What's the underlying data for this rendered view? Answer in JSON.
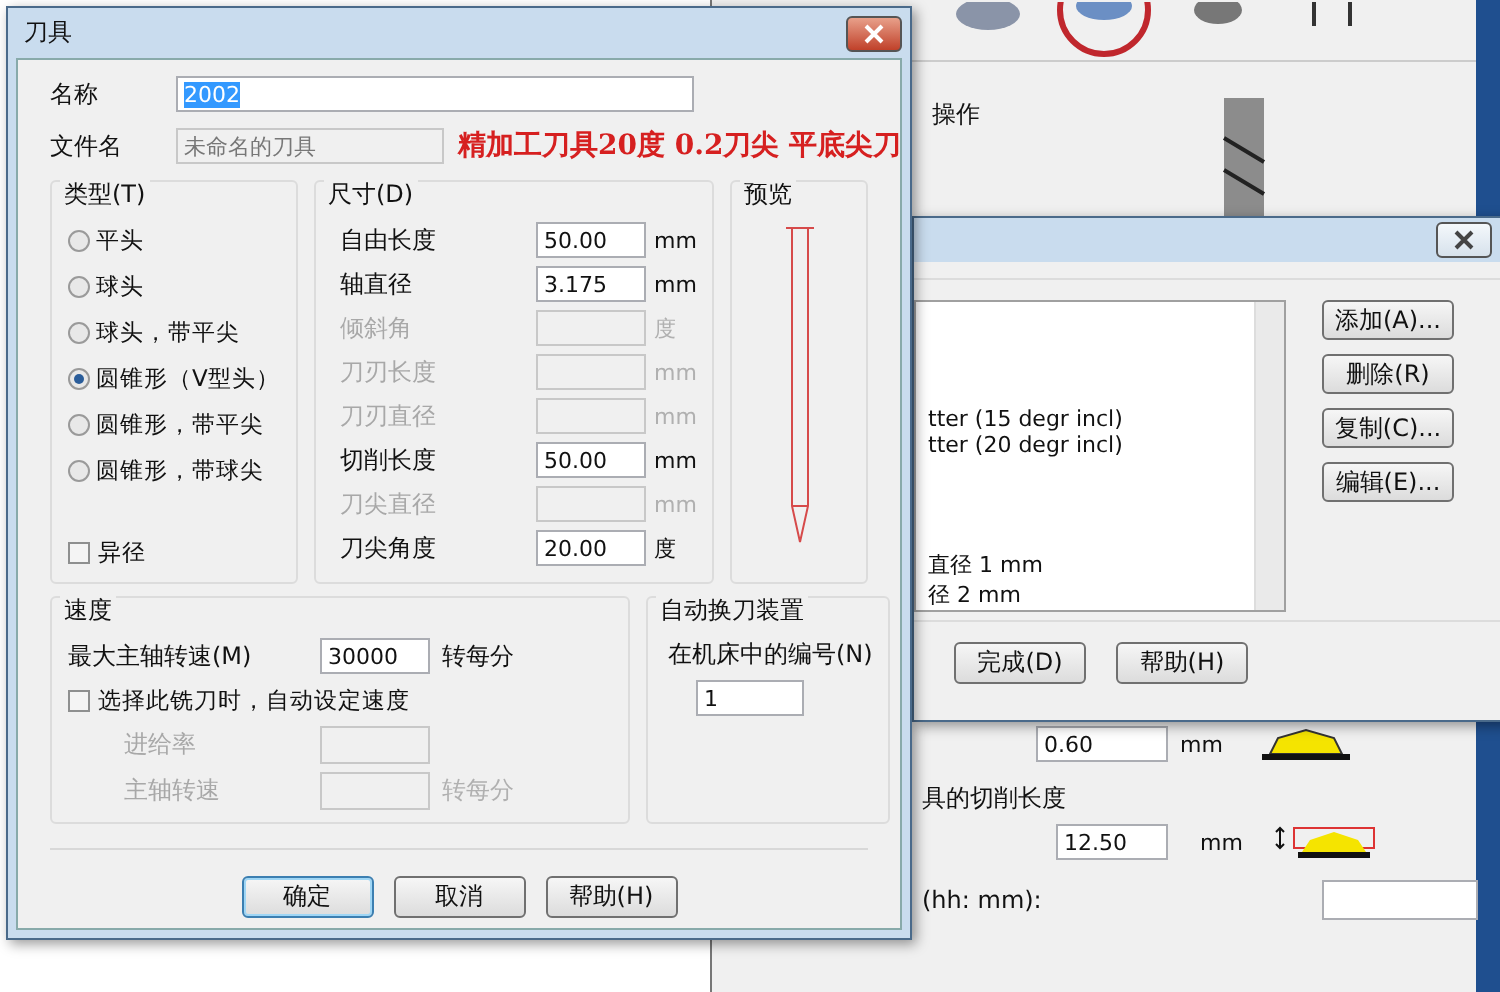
{
  "tool_dialog": {
    "title": "刀具",
    "name": {
      "label": "名称",
      "value": "2002",
      "selected": true
    },
    "file_name": {
      "label": "文件名",
      "value": "未命名的刀具",
      "disabled": true
    },
    "annotation": "精加工刀具20度 0.2刀尖 平底尖刀",
    "type_group": {
      "title": "类型(T)",
      "options": [
        {
          "label": "平头",
          "selected": false
        },
        {
          "label": "球头",
          "selected": false
        },
        {
          "label": "球头，带平尖",
          "selected": false
        },
        {
          "label": "圆锥形（V型头）",
          "selected": true
        },
        {
          "label": "圆锥形，带平尖",
          "selected": false
        },
        {
          "label": "圆锥形，带球尖",
          "selected": false
        }
      ],
      "odd_diameter": {
        "label": "异径",
        "checked": false
      }
    },
    "dimensions": {
      "title": "尺寸(D)",
      "rows": [
        {
          "label": "自由长度",
          "value": "50.00",
          "unit": "mm",
          "disabled": false
        },
        {
          "label": "轴直径",
          "value": "3.175",
          "unit": "mm",
          "disabled": false
        },
        {
          "label": "倾斜角",
          "unit": "度",
          "disabled": true
        },
        {
          "label": "刀刃长度",
          "unit": "mm",
          "disabled": true
        },
        {
          "label": "刀刃直径",
          "unit": "mm",
          "disabled": true
        },
        {
          "label": "切削长度",
          "value": "50.00",
          "unit": "mm",
          "disabled": false
        },
        {
          "label": "刀尖直径",
          "unit": "mm",
          "disabled": true
        },
        {
          "label": "刀尖角度",
          "value": "20.00",
          "unit": "度",
          "disabled": false
        }
      ]
    },
    "preview": {
      "title": "预览"
    },
    "speed": {
      "title": "速度",
      "max_spindle": {
        "label": "最大主轴转速(M)",
        "value": "30000",
        "unit": "转每分"
      },
      "auto_set": {
        "label": "选择此铣刀时，自动设定速度",
        "checked": false
      },
      "sub_rows": [
        {
          "label": "进给率",
          "disabled": true
        },
        {
          "label": "主轴转速",
          "unit": "转每分",
          "disabled": true
        }
      ]
    },
    "tool_changer": {
      "title": "自动换刀装置",
      "number": {
        "label": "在机床中的编号(N)",
        "value": "1"
      }
    },
    "buttons": [
      {
        "label": "确定",
        "default": true
      },
      {
        "label": "取消",
        "default": false
      },
      {
        "label": "帮助(H)",
        "default": false
      }
    ]
  },
  "library_dialog": {
    "list_items": [
      {
        "label": "tter (15 degr incl)"
      },
      {
        "label": "tter (20 degr incl)"
      },
      {
        "label": "直径 1 mm"
      },
      {
        "label": "径 2 mm"
      }
    ],
    "side_buttons": [
      "添加(A)...",
      "删除(R)",
      "复制(C)...",
      "编辑(E)..."
    ],
    "bottom_buttons": [
      "完成(D)",
      "帮助(H)"
    ]
  },
  "background_window": {
    "heading": "操作",
    "stepover": {
      "value": "0.60",
      "unit": "mm"
    },
    "cut_length": {
      "label": "具的切削长度",
      "value": "12.50",
      "unit": "mm"
    },
    "time": {
      "label": "(hh: mm):"
    }
  }
}
